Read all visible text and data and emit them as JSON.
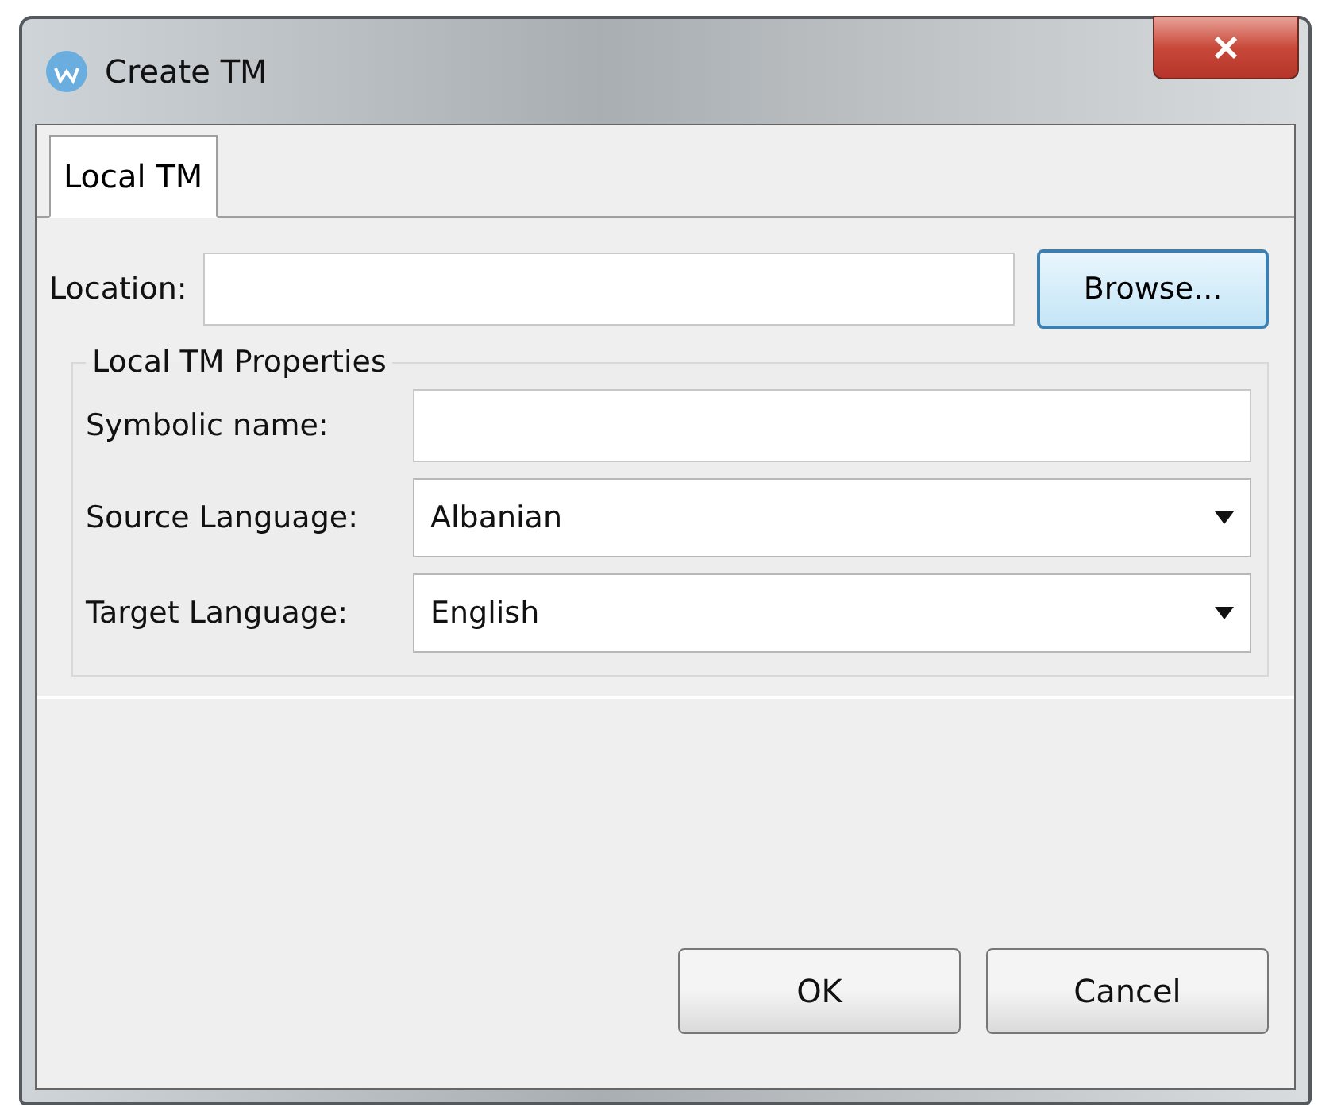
{
  "window": {
    "title": "Create TM"
  },
  "tabs": [
    {
      "label": "Local TM",
      "selected": true
    }
  ],
  "location": {
    "label": "Location:",
    "browse": {
      "label": "Browse...",
      "focused": true
    }
  },
  "properties": {
    "title": "Local TM Properties",
    "fields": [
      {
        "label": "Symbolic name:",
        "kind": "text"
      },
      {
        "label": "Source Language:",
        "kind": "select",
        "value": "Albanian"
      },
      {
        "label": "Target Language:",
        "kind": "select",
        "value": "English"
      }
    ]
  },
  "buttons": [
    {
      "label": "OK"
    },
    {
      "label": "Cancel"
    }
  ]
}
